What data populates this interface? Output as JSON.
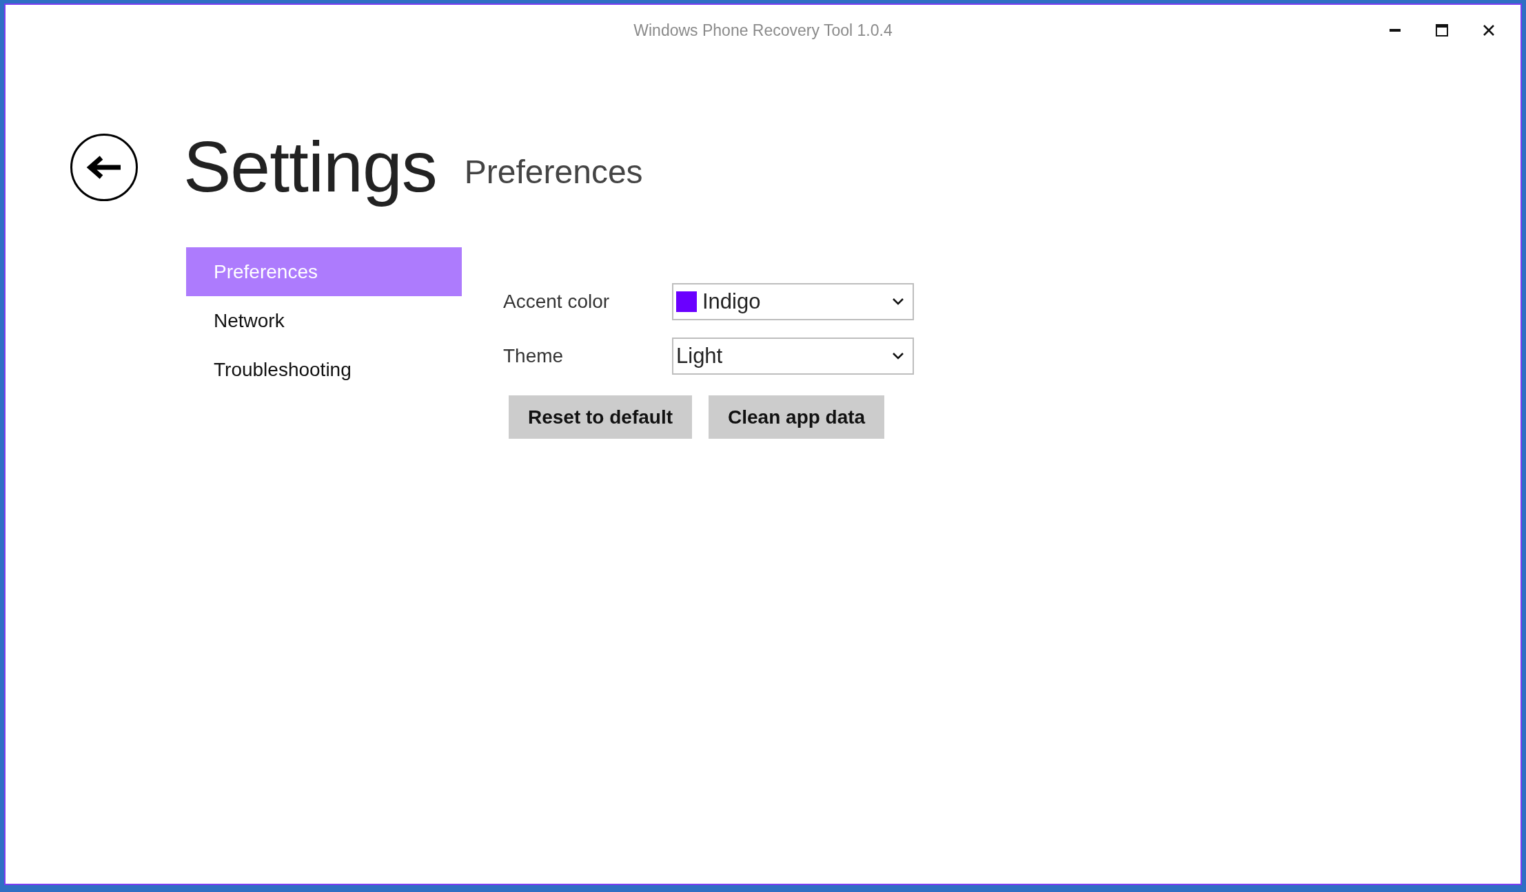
{
  "window": {
    "title": "Windows Phone Recovery Tool 1.0.4"
  },
  "header": {
    "title": "Settings",
    "subtitle": "Preferences"
  },
  "sidebar": {
    "items": [
      {
        "label": "Preferences",
        "selected": true
      },
      {
        "label": "Network",
        "selected": false
      },
      {
        "label": "Troubleshooting",
        "selected": false
      }
    ]
  },
  "fields": [
    {
      "label": "Accent color",
      "value": "Indigo",
      "color": "#6a00ff"
    },
    {
      "label": "Theme",
      "value": "Light"
    }
  ],
  "buttons": [
    "Reset to default",
    "Clean app data"
  ]
}
